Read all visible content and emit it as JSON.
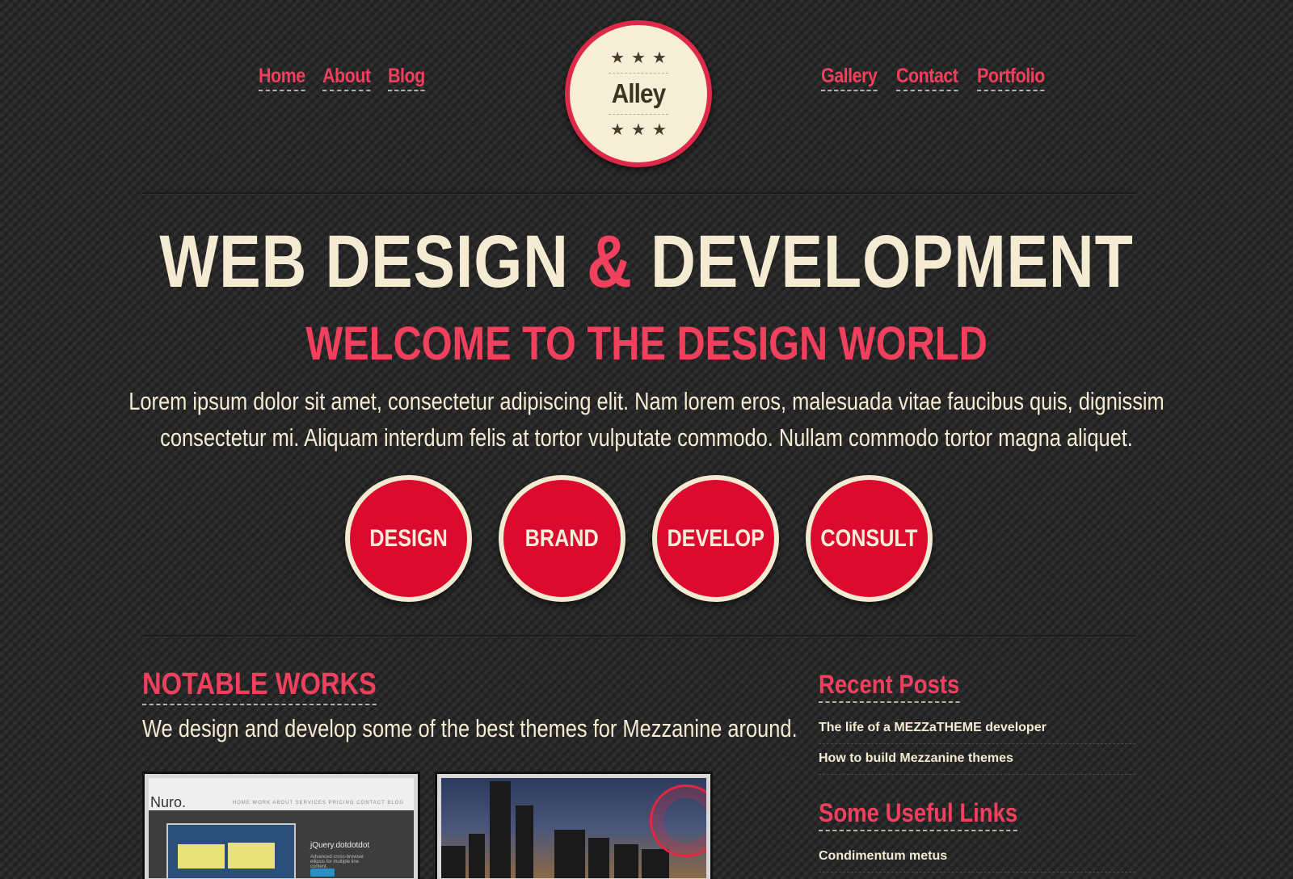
{
  "nav_left": [
    "Home",
    "About",
    "Blog"
  ],
  "nav_right": [
    "Gallery",
    "Contact",
    "Portfolio"
  ],
  "logo": {
    "stars": "★★★",
    "name": "Alley"
  },
  "hero": {
    "title_part1": "WEB DESIGN",
    "title_amp": "&",
    "title_part2": "DEVELOPMENT",
    "subtitle": "WELCOME TO THE DESIGN WORLD",
    "body_line1": "Lorem ipsum dolor sit amet, consectetur adipiscing elit. Nam lorem eros, malesuada vitae faucibus quis, dignissim",
    "body_line2": "consectetur mi. Aliquam interdum felis at tortor vulputate commodo. Nullam commodo tortor magna aliquet."
  },
  "services": [
    "DESIGN",
    "BRAND",
    "DEVELOP",
    "CONSULT"
  ],
  "notable": {
    "title": "NOTABLE WORKS",
    "description": "We design and develop some of the best themes for Mezzanine around.",
    "thumb1": {
      "brand": "Nuro.",
      "menu": "HOME  WORK  ABOUT  SERVICES  PRICING  CONTACT  BLOG",
      "heading": "jQuery.dotdotdot",
      "sub": "Advanced cross-browser ellipsis for multiple line content."
    }
  },
  "sidebar": {
    "recent_title": "Recent Posts",
    "recent_posts": [
      "The life of a MEZZaTHEME developer",
      "How to build Mezzanine themes"
    ],
    "links_title": "Some Useful Links",
    "links": [
      "Condimentum metus"
    ]
  },
  "colors": {
    "accent": "#f0405e",
    "cream": "#f4ebd2",
    "circle_red": "#dd0a2f",
    "background": "#2a2a2a"
  }
}
